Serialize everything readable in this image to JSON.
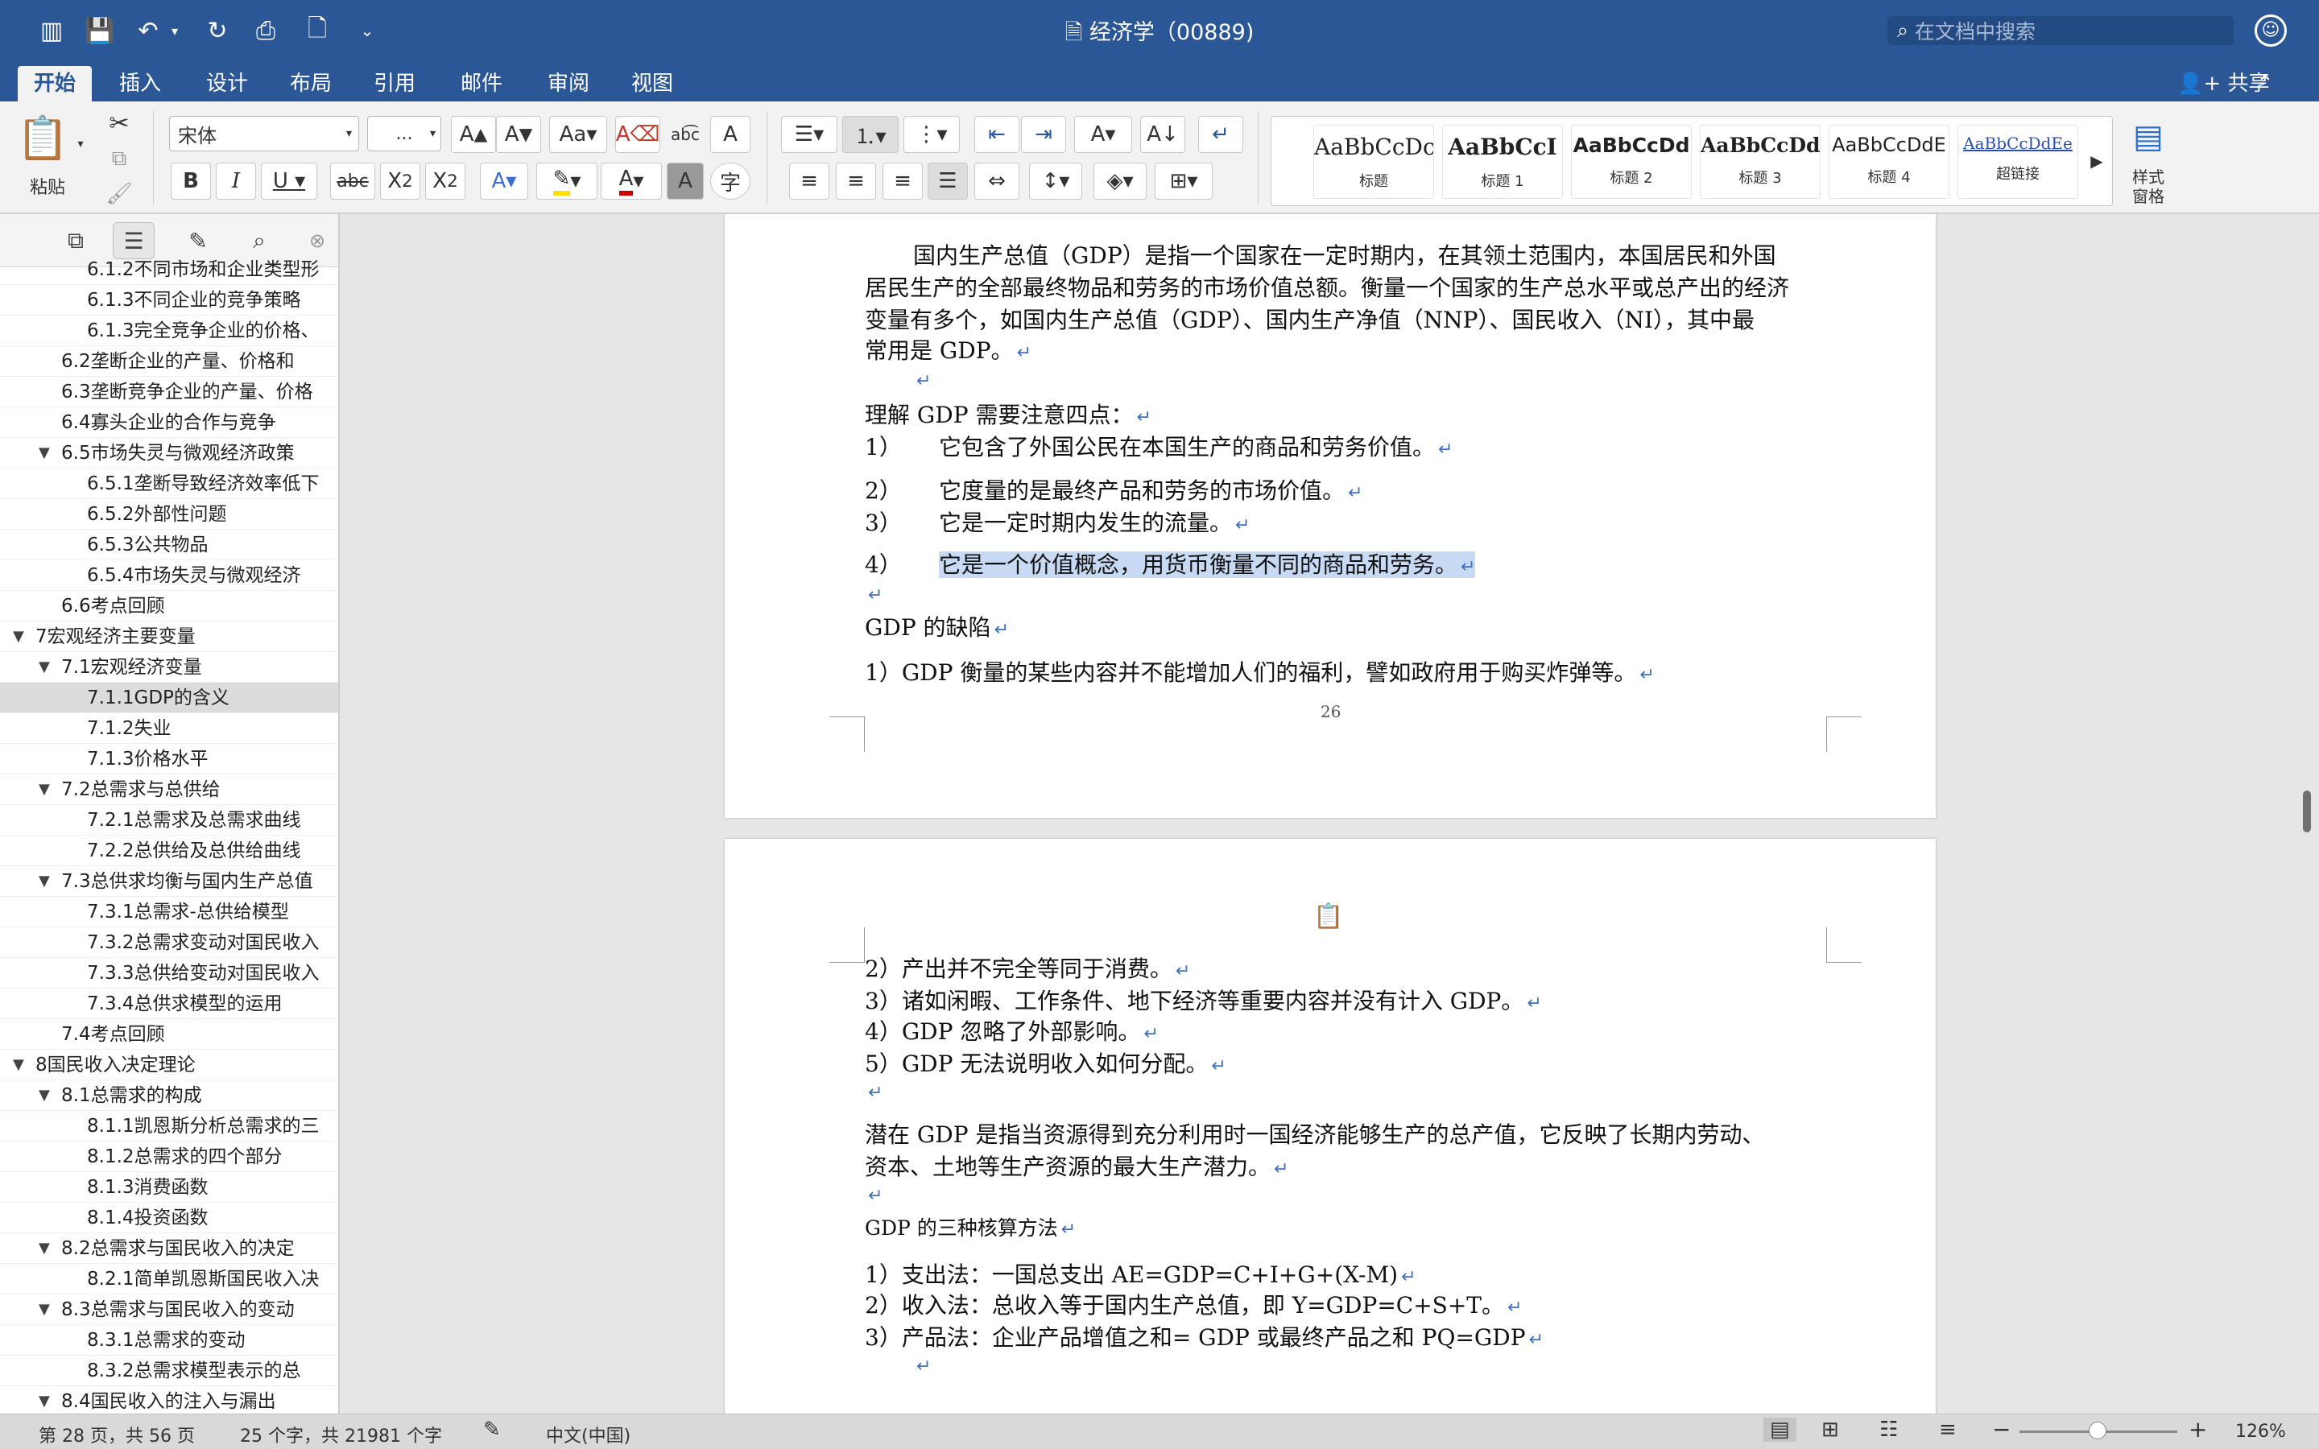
{
  "window": {
    "title": "经济学（00889)",
    "search_placeholder": "在文档中搜索",
    "share_label": "共享"
  },
  "tabs": [
    {
      "label": "开始"
    },
    {
      "label": "插入"
    },
    {
      "label": "设计"
    },
    {
      "label": "布局"
    },
    {
      "label": "引用"
    },
    {
      "label": "邮件"
    },
    {
      "label": "审阅"
    },
    {
      "label": "视图"
    }
  ],
  "ribbon": {
    "paste_label": "粘贴",
    "font_name": "宋体",
    "font_size": "...",
    "styles_pane_label_1": "样式",
    "styles_pane_label_2": "窗格",
    "styles": [
      {
        "sample": "AaBbCcDc",
        "name": "标题"
      },
      {
        "sample": "AaBbCcI",
        "name": "标题 1"
      },
      {
        "sample": "AaBbCcDd",
        "name": "标题 2"
      },
      {
        "sample": "AaBbCcDd",
        "name": "标题 3"
      },
      {
        "sample": "AaBbCcDdE",
        "name": "标题 4"
      },
      {
        "sample": "AaBbCcDdEe",
        "name": "超链接"
      }
    ]
  },
  "nav": {
    "items": [
      {
        "label": "6.1.2不同市场和企业类型形",
        "level": 3
      },
      {
        "label": "6.1.3不同企业的竞争策略",
        "level": 3
      },
      {
        "label": "6.1.3完全竞争企业的价格、",
        "level": 3
      },
      {
        "label": "6.2垄断企业的产量、价格和",
        "level": 2
      },
      {
        "label": "6.3垄断竞争企业的产量、价格",
        "level": 2
      },
      {
        "label": "6.4寡头企业的合作与竞争",
        "level": 2
      },
      {
        "label": "6.5市场失灵与微观经济政策",
        "level": 2,
        "expanded": true
      },
      {
        "label": "6.5.1垄断导致经济效率低下",
        "level": 3
      },
      {
        "label": "6.5.2外部性问题",
        "level": 3
      },
      {
        "label": "6.5.3公共物品",
        "level": 3
      },
      {
        "label": "6.5.4市场失灵与微观经济",
        "level": 3
      },
      {
        "label": "6.6考点回顾",
        "level": 2
      },
      {
        "label": "7宏观经济主要变量",
        "level": 1,
        "expanded": true
      },
      {
        "label": "7.1宏观经济变量",
        "level": 2,
        "expanded": true
      },
      {
        "label": "7.1.1GDP的含义",
        "level": 3,
        "selected": true
      },
      {
        "label": "7.1.2失业",
        "level": 3
      },
      {
        "label": "7.1.3价格水平",
        "level": 3
      },
      {
        "label": "7.2总需求与总供给",
        "level": 2,
        "expanded": true
      },
      {
        "label": "7.2.1总需求及总需求曲线",
        "level": 3
      },
      {
        "label": "7.2.2总供给及总供给曲线",
        "level": 3
      },
      {
        "label": "7.3总供求均衡与国内生产总值",
        "level": 2,
        "expanded": true
      },
      {
        "label": "7.3.1总需求-总供给模型",
        "level": 3
      },
      {
        "label": "7.3.2总需求变动对国民收入",
        "level": 3
      },
      {
        "label": "7.3.3总供给变动对国民收入",
        "level": 3
      },
      {
        "label": "7.3.4总供求模型的运用",
        "level": 3
      },
      {
        "label": "7.4考点回顾",
        "level": 2
      },
      {
        "label": "8国民收入决定理论",
        "level": 1,
        "expanded": true
      },
      {
        "label": "8.1总需求的构成",
        "level": 2,
        "expanded": true
      },
      {
        "label": "8.1.1凯恩斯分析总需求的三",
        "level": 3
      },
      {
        "label": "8.1.2总需求的四个部分",
        "level": 3
      },
      {
        "label": "8.1.3消费函数",
        "level": 3
      },
      {
        "label": "8.1.4投资函数",
        "level": 3
      },
      {
        "label": "8.2总需求与国民收入的决定",
        "level": 2,
        "expanded": true
      },
      {
        "label": "8.2.1简单凯恩斯国民收入决",
        "level": 3
      },
      {
        "label": "8.3总需求与国民收入的变动",
        "level": 2,
        "expanded": true
      },
      {
        "label": "8.3.1总需求的变动",
        "level": 3
      },
      {
        "label": "8.3.2总需求模型表示的总",
        "level": 3
      },
      {
        "label": "8.4国民收入的注入与漏出",
        "level": 2,
        "expanded": true
      }
    ]
  },
  "page1": {
    "para1": [
      "国内生产总值（GDP）是指一个国家在一定时期内，在其领土范围内，本国居民和外国",
      "居民生产的全部最终物品和劳务的市场价值总额。衡量一个国家的生产总水平或总产出的经济",
      "变量有多个，如国内生产总值（GDP）、国内生产净值（NNP）、国民收入（NI），其中最",
      "常用是 GDP。"
    ],
    "understand_heading": "理解 GDP 需要注意四点：",
    "points": [
      {
        "num": "1）",
        "text": "它包含了外国公民在本国生产的商品和劳务价值。"
      },
      {
        "num": "2）",
        "text": "它度量的是最终产品和劳务的市场价值。"
      },
      {
        "num": "3）",
        "text": "它是一定时期内发生的流量。"
      },
      {
        "num": "4）",
        "text": "它是一个价值概念，用货币衡量不同的商品和劳务。"
      }
    ],
    "defect_heading": "GDP 的缺陷",
    "defect1": "1）GDP 衡量的某些内容并不能增加人们的福利，譬如政府用于购买炸弹等。",
    "page_number": "26"
  },
  "page2": {
    "defects": [
      "2）产出并不完全等同于消费。",
      "3）诸如闲暇、工作条件、地下经济等重要内容并没有计入 GDP。",
      "4）GDP 忽略了外部影响。",
      "5）GDP 无法说明收入如何分配。"
    ],
    "potential": [
      "潜在 GDP 是指当资源得到充分利用时一国经济能够生产的总产值，它反映了长期内劳动、",
      "资本、土地等生产资源的最大生产潜力。"
    ],
    "methods_heading": "GDP 的三种核算方法",
    "methods": [
      "1）支出法：一国总支出 AE=GDP=C+I+G+(X-M)",
      "2）收入法：总收入等于国内生产总值，即 Y=GDP=C+S+T。",
      "3）产品法：企业产品增值之和= GDP 或最终产品之和 PQ=GDP"
    ]
  },
  "status": {
    "page": "第 28 页，共 56 页",
    "words": "25 个字，共 21981 个字",
    "language": "中文(中国)",
    "zoom": "126%"
  }
}
